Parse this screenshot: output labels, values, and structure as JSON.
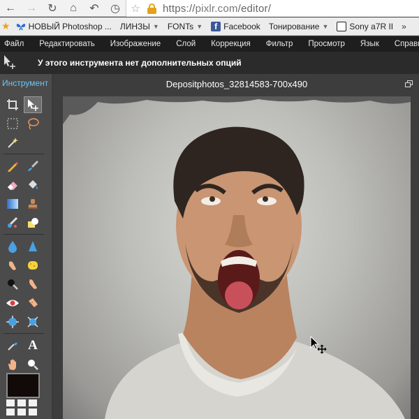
{
  "browser": {
    "url_scheme": "https://",
    "url_domain": "pixlr.com",
    "url_path": "/editor/"
  },
  "bookmarks": [
    {
      "label": "НОВЫЙ Photoshop ...",
      "icon": "butterfly-icon",
      "color": "#2b6cd8",
      "dropdown": false
    },
    {
      "label": "ЛИНЗЫ",
      "icon": "",
      "dropdown": true
    },
    {
      "label": "FONTs",
      "icon": "",
      "dropdown": true
    },
    {
      "label": "Facebook",
      "icon": "facebook-icon",
      "color": "#3b5998",
      "dropdown": false
    },
    {
      "label": "Тонирование",
      "icon": "",
      "dropdown": true
    },
    {
      "label": "Sony a7R II",
      "icon": "page-icon",
      "color": "#222222",
      "dropdown": false
    }
  ],
  "menu": [
    "Файл",
    "Редактировать",
    "Изображение",
    "Слой",
    "Коррекция",
    "Фильтр",
    "Просмотр",
    "Язык",
    "Справка"
  ],
  "options_bar": {
    "message": "У этого инструмента нет дополнительных опций"
  },
  "tools_panel": {
    "title": "Инструмент"
  },
  "canvas": {
    "document_title": "Depositphotos_32814583-700x490"
  },
  "colors": {
    "accent": "#6cc6f5",
    "menubar_bg": "#1e1e1e",
    "panel_bg": "#4b4b4b",
    "foreground_color": "#120909"
  }
}
